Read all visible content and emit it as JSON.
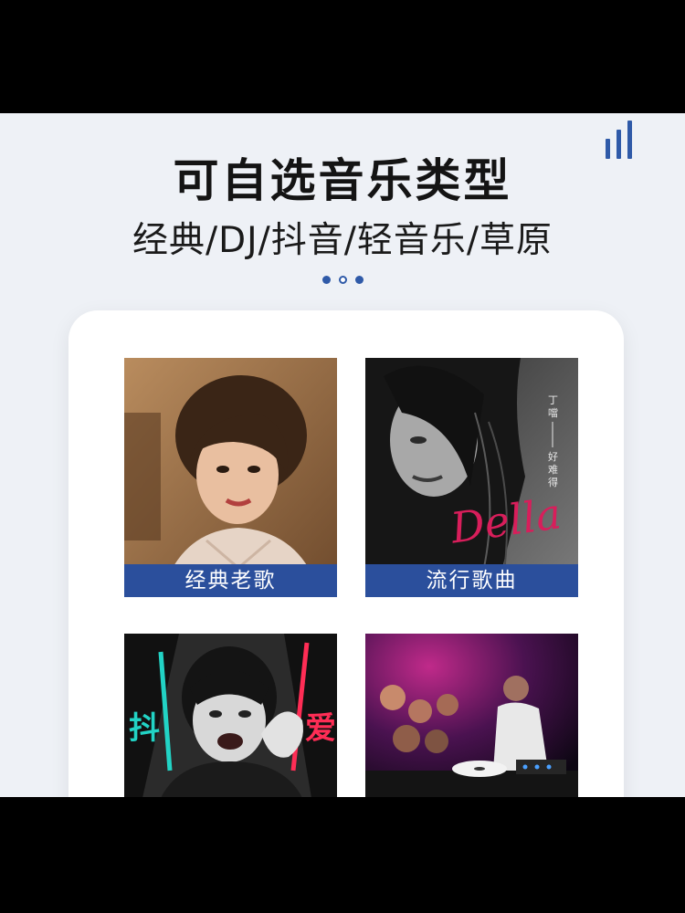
{
  "header": {
    "title": "可自选音乐类型",
    "subtitle": "经典/DJ/抖音/轻音乐/草原"
  },
  "pager": {
    "count": 3,
    "active": 1
  },
  "categories": [
    {
      "label": "经典老歌",
      "image": "classic-singer-portrait"
    },
    {
      "label": "流行歌曲",
      "image": "pop-album-cover",
      "cover_text": [
        "丁",
        "噹",
        "好",
        "难",
        "得"
      ],
      "cover_signature": "Della"
    },
    {
      "label": "",
      "image": "douyin-girl-portrait",
      "overlay_text": [
        "抖",
        "爱"
      ]
    },
    {
      "label": "",
      "image": "dj-club-party"
    }
  ],
  "colors": {
    "accent": "#2b4f9c",
    "background": "#eef1f6",
    "card": "#ffffff",
    "title": "#141414"
  }
}
